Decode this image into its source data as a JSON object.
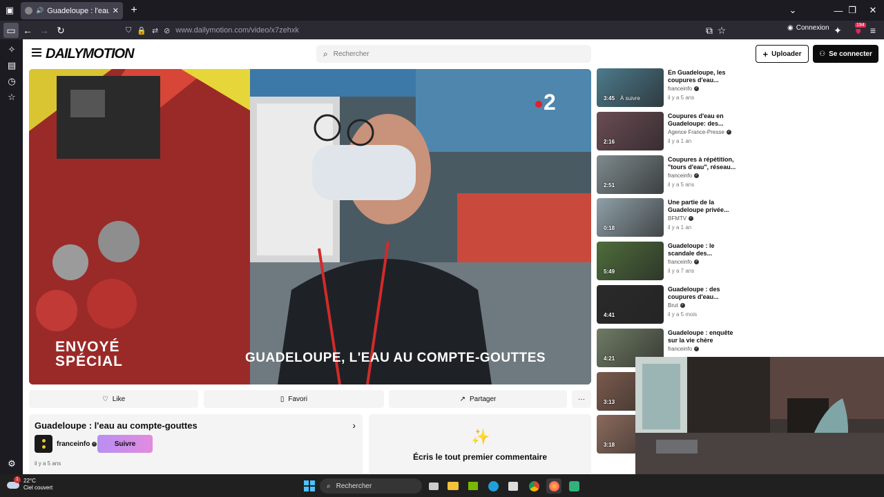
{
  "browser": {
    "tab_title": "Guadeloupe : l'eau au compte-gouttes",
    "url": "www.dailymotion.com/video/x7zehxk",
    "connexion_label": "Connexion",
    "badge_count": "194"
  },
  "header": {
    "logo": "DAILYMOTION",
    "search_placeholder": "Rechercher",
    "upload_label": "Uploader",
    "login_label": "Se connecter"
  },
  "video": {
    "overlay_show": "ENVOYÉ SPÉCIAL",
    "overlay_show_line1": "ENVOYÉ",
    "overlay_show_line2": "SPÉCIAL",
    "overlay_title": "GUADELOUPE, L'EAU AU COMPTE-GOUTTES",
    "channel_logo": "2"
  },
  "actions": {
    "like": "Like",
    "favori": "Favori",
    "partager": "Partager",
    "more": "···"
  },
  "info": {
    "title": "Guadeloupe : l'eau au compte-gouttes",
    "channel": "franceinfo",
    "follow": "Suivre",
    "date": "il y a 5 ans"
  },
  "comment": {
    "prompt": "Écris le tout premier commentaire"
  },
  "related": [
    {
      "title": "En Guadeloupe, les coupures d'eau...",
      "channel": "franceinfo",
      "age": "il y a 5 ans",
      "duration": "3:45",
      "next": "À suivre",
      "color": "#4d7a8c"
    },
    {
      "title": "Coupures d'eau en Guadeloupe: des...",
      "channel": "Agence France-Presse",
      "age": "il y a 1 an",
      "duration": "2:16",
      "next": "",
      "color": "#6b4c55"
    },
    {
      "title": "Coupures à répétition, \"tours d'eau\", réseau...",
      "channel": "franceinfo",
      "age": "il y a 5 ans",
      "duration": "2:51",
      "next": "",
      "color": "#7d8a8e"
    },
    {
      "title": "Une partie de la Guadeloupe privée...",
      "channel": "BFMTV",
      "age": "il y a 1 an",
      "duration": "0:18",
      "next": "",
      "color": "#8fa0a8"
    },
    {
      "title": "Guadeloupe : le scandale des...",
      "channel": "franceinfo",
      "age": "il y a 7 ans",
      "duration": "5:49",
      "next": "",
      "color": "#4e6d3b"
    },
    {
      "title": "Guadeloupe : des coupures d'eau...",
      "channel": "Brut",
      "age": "il y a 5 mois",
      "duration": "4:41",
      "next": "",
      "color": "#2a2a2a"
    },
    {
      "title": "Guadeloupe : enquête sur la vie chère",
      "channel": "franceinfo",
      "age": "",
      "duration": "4:21",
      "next": "",
      "color": "#6f7b64"
    },
    {
      "title": "",
      "channel": "",
      "age": "",
      "duration": "3:13",
      "next": "",
      "color": "#7a5a4c"
    },
    {
      "title": "",
      "channel": "",
      "age": "",
      "duration": "3:18",
      "next": "",
      "color": "#8a6a5c"
    }
  ],
  "taskbar": {
    "temperature": "22°C",
    "weather": "Ciel couvert",
    "search_label": "Rechercher",
    "notification": "1"
  }
}
